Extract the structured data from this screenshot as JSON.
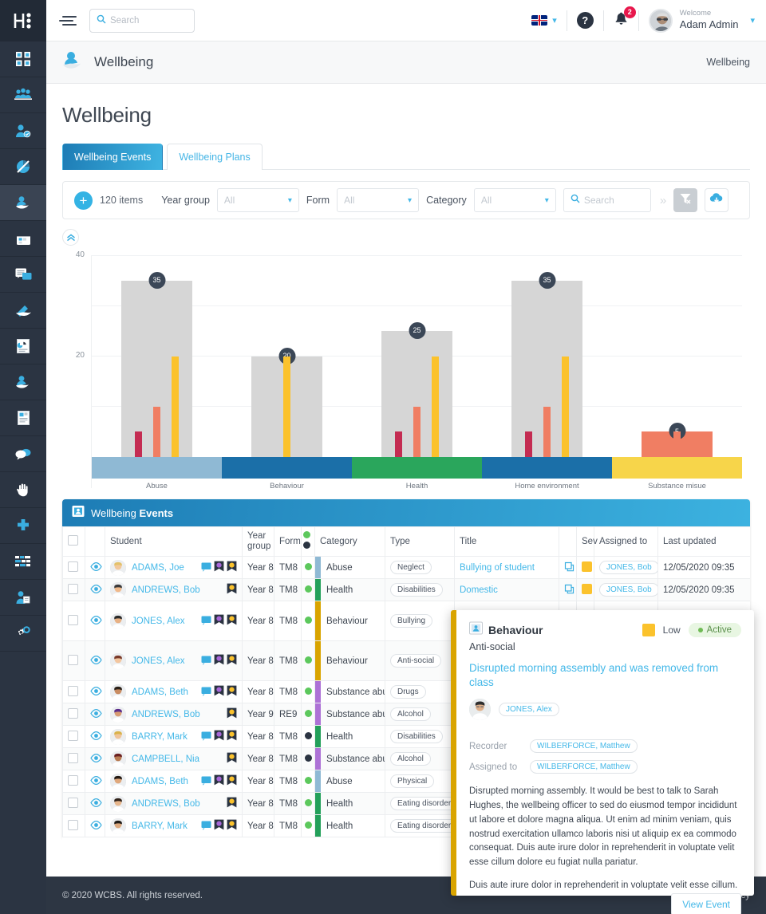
{
  "brand": {
    "logo": "hi-logo"
  },
  "topbar": {
    "search_placeholder": "Search",
    "language": "en-gb-flag",
    "help": "?",
    "notification_count": "2",
    "welcome_label": "Welcome",
    "user_name": "Adam Admin"
  },
  "pagehead": {
    "title": "Wellbeing",
    "breadcrumb": "Wellbeing"
  },
  "page": {
    "title": "Wellbeing"
  },
  "tabs": [
    {
      "label": "Wellbeing Events",
      "active": true
    },
    {
      "label": "Wellbeing Plans",
      "active": false
    }
  ],
  "filterbar": {
    "add_label": "+",
    "items_count": "120 items",
    "year_group_label": "Year group",
    "year_group_value": "All",
    "form_label": "Form",
    "form_value": "All",
    "category_label": "Category",
    "category_value": "All",
    "search_placeholder": "Search",
    "expand_label": "»"
  },
  "sidebar": {
    "items": [
      {
        "name": "dashboard",
        "label": "Dashboard"
      },
      {
        "name": "groups",
        "label": "Groups"
      },
      {
        "name": "attendance",
        "label": "Attendance"
      },
      {
        "name": "analysis",
        "label": "Analysis"
      },
      {
        "name": "wellbeing",
        "label": "Wellbeing",
        "active": true
      },
      {
        "name": "calendar",
        "label": "Calendar"
      },
      {
        "name": "messages",
        "label": "Messages"
      },
      {
        "name": "marking",
        "label": "Marking"
      },
      {
        "name": "reports",
        "label": "Reports"
      },
      {
        "name": "pastoral",
        "label": "Pastoral"
      },
      {
        "name": "documents",
        "label": "Documents"
      },
      {
        "name": "discussions",
        "label": "Discussions"
      },
      {
        "name": "behaviour",
        "label": "Behaviour"
      },
      {
        "name": "medical",
        "label": "Medical"
      },
      {
        "name": "timetable",
        "label": "Timetable"
      },
      {
        "name": "staff",
        "label": "Staff"
      },
      {
        "name": "settings",
        "label": "Settings"
      }
    ]
  },
  "chart_data": {
    "type": "bar",
    "title": "",
    "xlabel": "",
    "ylabel": "",
    "ylim": [
      0,
      40
    ],
    "yticks": [
      20,
      40
    ],
    "grid": true,
    "categories": [
      "Abuse",
      "Behaviour",
      "Health",
      "Home environment",
      "Substance misue"
    ],
    "category_colors": [
      "#8fb9d4",
      "#1b6fa8",
      "#2aa65c",
      "#1b6fa8",
      "#f7d54a"
    ],
    "totals": [
      35,
      20,
      25,
      35,
      5
    ],
    "total_bar_color": "#d6d6d6",
    "series": [
      {
        "name": "high",
        "color": "#c42c52",
        "values": [
          5,
          0,
          5,
          5,
          0
        ]
      },
      {
        "name": "medium",
        "color": "#f07e63",
        "values": [
          10,
          0,
          10,
          10,
          5
        ]
      },
      {
        "name": "low",
        "color": "#fbc22c",
        "values": [
          20,
          20,
          20,
          20,
          0
        ]
      }
    ]
  },
  "table": {
    "panel_title_prefix": "Wellbeing ",
    "panel_title_bold": "Events",
    "columns": [
      "",
      "",
      "Student",
      "Year group",
      "Form",
      "",
      "Category",
      "Type",
      "Title",
      "",
      "Sev",
      "Assigned to",
      "Last updated"
    ],
    "rows": [
      {
        "student": "ADAMS, Joe",
        "year": "Year 8",
        "form": "TM8",
        "statusdot": "#5cc85c",
        "category": "Abuse",
        "catcolor": "#8fb9d4",
        "type": "Neglect",
        "title": "Bullying of student",
        "sev": "#fbc22c",
        "assigned": "JONES, Bob",
        "updated": "12/05/2020 09:35",
        "icons": [
          "chat",
          "purple",
          "yellow"
        ]
      },
      {
        "student": "ANDREWS, Bob",
        "year": "Year 8",
        "form": "TM8",
        "statusdot": "#5cc85c",
        "category": "Health",
        "catcolor": "#23a05a",
        "type": "Disabilities",
        "title": "Domestic",
        "sev": "#fbc22c",
        "assigned": "JONES, Bob",
        "updated": "12/05/2020 09:35",
        "icons": [
          "yellow"
        ]
      },
      {
        "student": "JONES, Alex",
        "year": "Year 8",
        "form": "TM8",
        "statusdot": "#5cc85c",
        "category": "Behaviour",
        "catcolor": "#d9a400",
        "type": "Bullying",
        "title": "",
        "sev": "",
        "assigned": "",
        "updated": "",
        "icons": [
          "chat",
          "purple",
          "yellow"
        ],
        "tall": true
      },
      {
        "student": "JONES, Alex",
        "year": "Year 8",
        "form": "TM8",
        "statusdot": "#5cc85c",
        "category": "Behaviour",
        "catcolor": "#d9a400",
        "type": "Anti-social",
        "title": "",
        "sev": "",
        "assigned": "",
        "updated": "",
        "icons": [
          "chat",
          "purple",
          "yellow"
        ],
        "tall": true
      },
      {
        "student": "ADAMS, Beth",
        "year": "Year 8",
        "form": "TM8",
        "statusdot": "#5cc85c",
        "category": "Substance abuse",
        "catcolor": "#ad72d6",
        "type": "Drugs",
        "title": "",
        "sev": "",
        "assigned": "",
        "updated": "",
        "icons": [
          "chat",
          "purple",
          "yellow"
        ]
      },
      {
        "student": "ANDREWS, Bob",
        "year": "Year 9",
        "form": "RE9",
        "statusdot": "#5cc85c",
        "category": "Substance abuse",
        "catcolor": "#ad72d6",
        "type": "Alcohol",
        "title": "",
        "sev": "",
        "assigned": "",
        "updated": "",
        "icons": [
          "yellow"
        ]
      },
      {
        "student": "BARRY, Mark",
        "year": "Year 8",
        "form": "TM8",
        "statusdot": "#2b3442",
        "category": "Health",
        "catcolor": "#23a05a",
        "type": "Disabilities",
        "title": "",
        "sev": "",
        "assigned": "",
        "updated": "",
        "icons": [
          "chat",
          "purple",
          "yellow"
        ]
      },
      {
        "student": "CAMPBELL, Nia",
        "year": "Year 8",
        "form": "TM8",
        "statusdot": "#2b3442",
        "category": "Substance abuse",
        "catcolor": "#ad72d6",
        "type": "Alcohol",
        "title": "",
        "sev": "",
        "assigned": "",
        "updated": "",
        "icons": [
          "yellow"
        ]
      },
      {
        "student": "ADAMS, Beth",
        "year": "Year 8",
        "form": "TM8",
        "statusdot": "#5cc85c",
        "category": "Abuse",
        "catcolor": "#8fb9d4",
        "type": "Physical",
        "title": "",
        "sev": "",
        "assigned": "",
        "updated": "",
        "icons": [
          "chat",
          "purple",
          "yellow"
        ]
      },
      {
        "student": "ANDREWS, Bob",
        "year": "Year 8",
        "form": "TM8",
        "statusdot": "#5cc85c",
        "category": "Health",
        "catcolor": "#23a05a",
        "type": "Eating disorder",
        "title": "",
        "sev": "",
        "assigned": "",
        "updated": "",
        "icons": [
          "yellow"
        ]
      },
      {
        "student": "BARRY, Mark",
        "year": "Year 8",
        "form": "TM8",
        "statusdot": "#5cc85c",
        "category": "Health",
        "catcolor": "#23a05a",
        "type": "Eating disorder",
        "title": "",
        "sev": "",
        "assigned": "",
        "updated": "",
        "icons": [
          "chat",
          "purple",
          "yellow"
        ]
      }
    ]
  },
  "popup": {
    "category": "Behaviour",
    "type": "Anti-social",
    "severity_label": "Low",
    "severity_color": "#fbc22c",
    "status": "Active",
    "title": "Disrupted morning assembly and was removed from class",
    "student": "JONES, Alex",
    "recorder_label": "Recorder",
    "recorder": "WILBERFORCE, Matthew",
    "assigned_label": "Assigned to",
    "assigned": "WILBERFORCE, Matthew",
    "description_p1": "Disrupted morning assembly. It would be best to talk to Sarah Hughes, the wellbeing officer to sed do eiusmod tempor incididunt ut labore et dolore magna aliqua. Ut enim ad minim veniam, quis nostrud exercitation ullamco laboris nisi ut aliquip ex ea commodo consequat. Duis aute irure dolor in reprehenderit in voluptate velit esse cillum dolore eu fugiat nulla pariatur.",
    "description_p2": "Duis aute irure dolor in reprehenderit in voluptate velit esse cillum.",
    "button": "View Event"
  },
  "footer": {
    "copyright": "© 2020 WCBS.  All rights reserved.",
    "privacy": "Privacy Policy"
  }
}
